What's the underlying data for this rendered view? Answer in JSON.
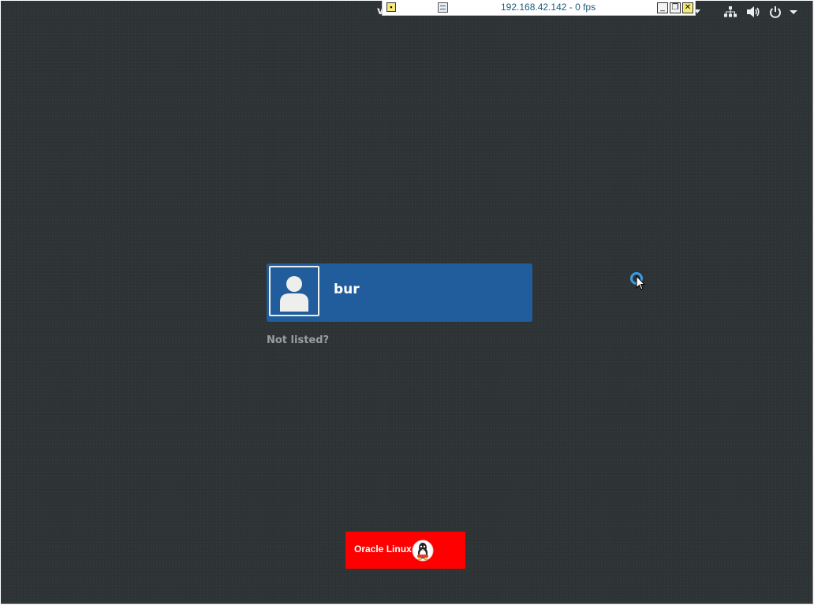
{
  "vnc_toolbar": {
    "title": "192.168.42.142 - 0 fps"
  },
  "peek": {
    "letter": "v"
  },
  "tray": {
    "icons": [
      "network-icon",
      "volume-icon",
      "power-icon",
      "chevron-down-icon"
    ]
  },
  "login": {
    "user_name": "bur",
    "not_listed": "Not listed?"
  },
  "branding": {
    "logo_text": "Oracle Linux"
  },
  "colors": {
    "background": "#2e3436",
    "user_card": "#215d9c",
    "logo": "#ff0000",
    "cursor_ring": "#3a9be6"
  }
}
